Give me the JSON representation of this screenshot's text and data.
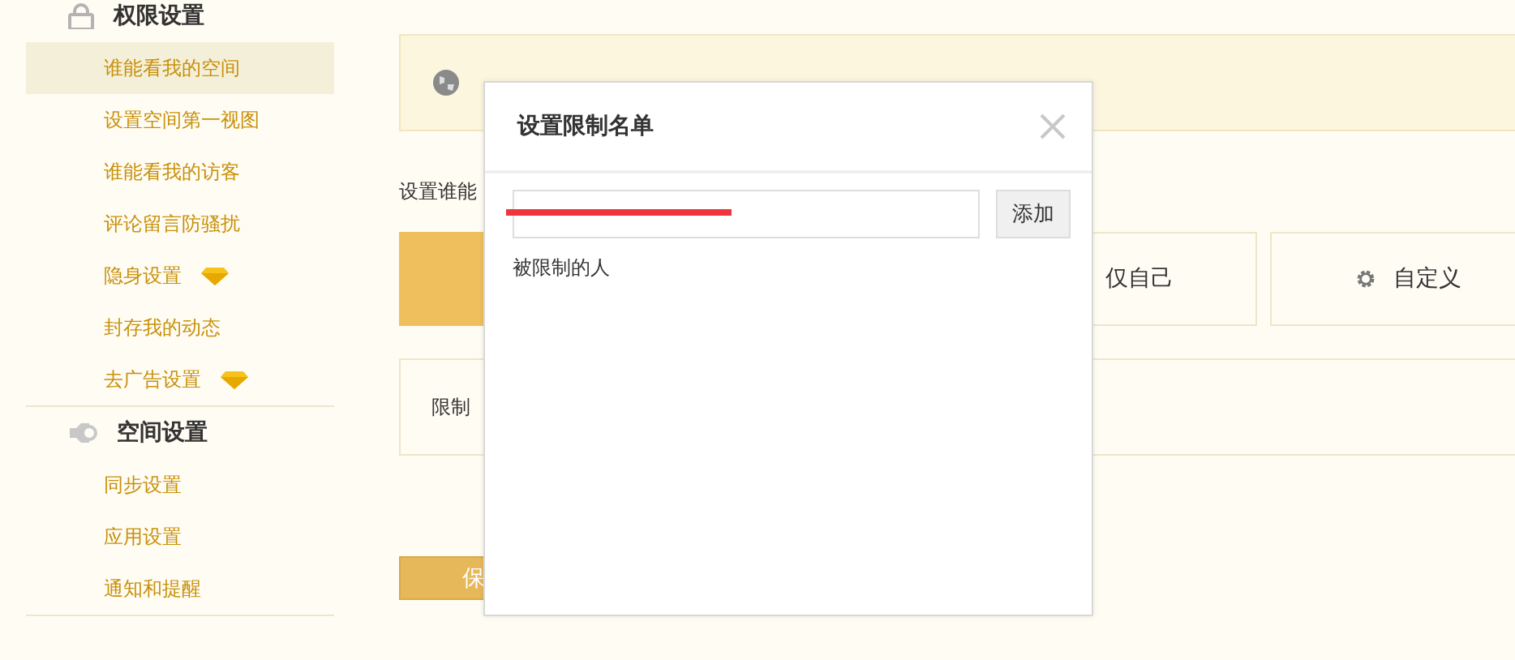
{
  "sidebar": {
    "sections": [
      {
        "title": "权限设置",
        "items": [
          {
            "label": "谁能看我的空间",
            "selected": true
          },
          {
            "label": "设置空间第一视图",
            "selected": false
          },
          {
            "label": "谁能看我的访客",
            "selected": false
          },
          {
            "label": "评论留言防骚扰",
            "selected": false
          },
          {
            "label": "隐身设置",
            "selected": false,
            "vip": true
          },
          {
            "label": "封存我的动态",
            "selected": false
          },
          {
            "label": "去广告设置",
            "selected": false,
            "vip": true
          }
        ]
      },
      {
        "title": "空间设置",
        "items": [
          {
            "label": "同步设置",
            "selected": false
          },
          {
            "label": "应用设置",
            "selected": false
          },
          {
            "label": "通知和提醒",
            "selected": false
          }
        ]
      }
    ]
  },
  "prompt": "设置谁能",
  "options": [
    {
      "kind": "plain",
      "selected": true
    },
    {
      "kind": "plain",
      "label": "仅自己",
      "selected": false
    },
    {
      "kind": "custom",
      "label": "自定义",
      "selected": false
    }
  ],
  "restricted": {
    "label": "限制"
  },
  "save_button": "保",
  "dialog": {
    "title": "设置限制名单",
    "add_button": "添加",
    "list_label": "被限制的人"
  }
}
